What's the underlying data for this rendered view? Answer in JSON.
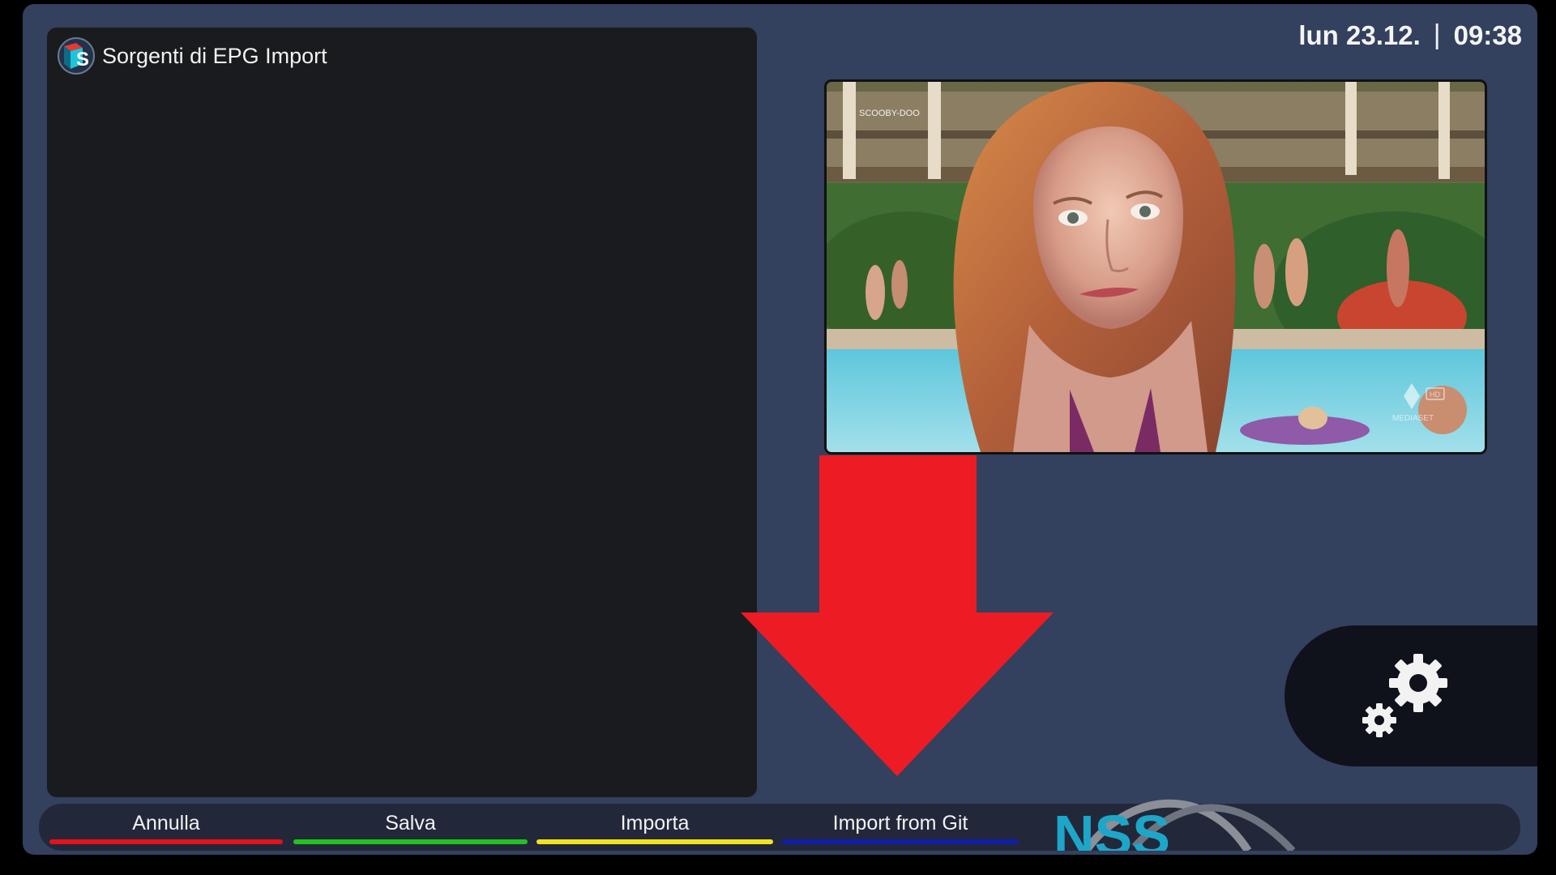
{
  "header": {
    "title": "Sorgenti di EPG Import",
    "logo_icon": "nss-logo-icon",
    "date": "lun 23.12.",
    "separator": "|",
    "time": "09:38"
  },
  "preview": {
    "channel_watermark": "SCOOBY-DOO",
    "broadcaster_watermark": "MEDIASET",
    "hd_badge": "HD"
  },
  "annotation": {
    "icon": "red-arrow-down-icon",
    "color": "#ed1c24"
  },
  "settings": {
    "icon": "gear-icon"
  },
  "bottom_bar": {
    "actions": [
      {
        "label": "Annulla",
        "color": "#e3121b",
        "icon": "red-button"
      },
      {
        "label": "Salva",
        "color": "#21c31f",
        "icon": "green-button"
      },
      {
        "label": "Importa",
        "color": "#f4e31c",
        "icon": "yellow-button"
      },
      {
        "label": "Import from Git",
        "color": "#121ea8",
        "icon": "blue-button"
      }
    ],
    "brand_text": "NSS"
  },
  "colors": {
    "frame": "#33405e",
    "panel": "#1a1b1e",
    "bar": "#22283a"
  }
}
